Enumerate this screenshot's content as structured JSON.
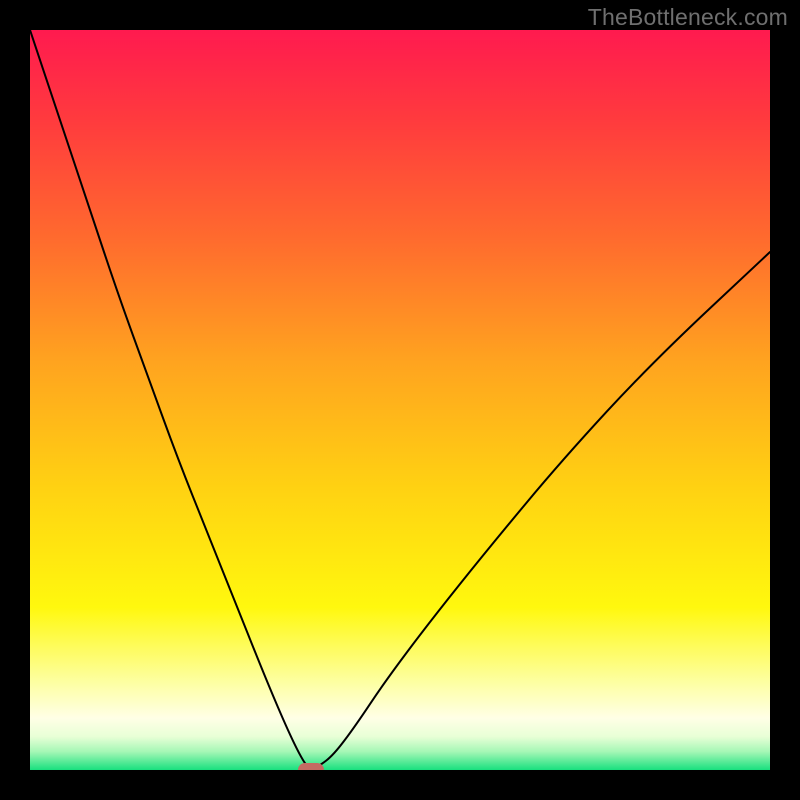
{
  "watermark": {
    "text": "TheBottleneck.com",
    "color": "#6f6f6f"
  },
  "frame": {
    "border_color": "#000000",
    "border_px": 30
  },
  "plot": {
    "inner_w": 740,
    "inner_h": 740
  },
  "gradient": {
    "type": "vertical",
    "stops": [
      {
        "offset": 0.0,
        "color": "#ff1a4f"
      },
      {
        "offset": 0.12,
        "color": "#ff3a3e"
      },
      {
        "offset": 0.28,
        "color": "#ff6a2e"
      },
      {
        "offset": 0.45,
        "color": "#ffa41f"
      },
      {
        "offset": 0.62,
        "color": "#ffd212"
      },
      {
        "offset": 0.78,
        "color": "#fff80e"
      },
      {
        "offset": 0.88,
        "color": "#fdffa0"
      },
      {
        "offset": 0.93,
        "color": "#ffffe6"
      },
      {
        "offset": 0.955,
        "color": "#e8ffd6"
      },
      {
        "offset": 0.975,
        "color": "#a6f7b6"
      },
      {
        "offset": 1.0,
        "color": "#18e07e"
      }
    ]
  },
  "chart_data": {
    "type": "line",
    "title": "",
    "xlabel": "",
    "ylabel": "",
    "xlim": [
      0,
      100
    ],
    "ylim": [
      0,
      100
    ],
    "grid": false,
    "legend": false,
    "notes": "V-shaped bottleneck curve. Axis values are unlabeled in the image; x/y are normalized 0–100 (percent of plot extent). Minimum of the curve is at roughly x≈38, y≈0.",
    "series": [
      {
        "name": "bottleneck-curve",
        "color": "#000000",
        "stroke_px": 2,
        "x": [
          0,
          4,
          8,
          12,
          16,
          20,
          24,
          28,
          32,
          35,
          37,
          38,
          39,
          41,
          44,
          48,
          54,
          62,
          72,
          84,
          100
        ],
        "y": [
          100,
          88,
          76,
          64,
          53,
          42,
          32,
          22,
          12,
          5,
          1,
          0,
          0.5,
          2,
          6,
          12,
          20,
          30,
          42,
          55,
          70
        ]
      }
    ],
    "marker": {
      "name": "optimal-point",
      "shape": "rounded-rect",
      "x": 38,
      "y": 0,
      "color": "#c46a62"
    }
  }
}
